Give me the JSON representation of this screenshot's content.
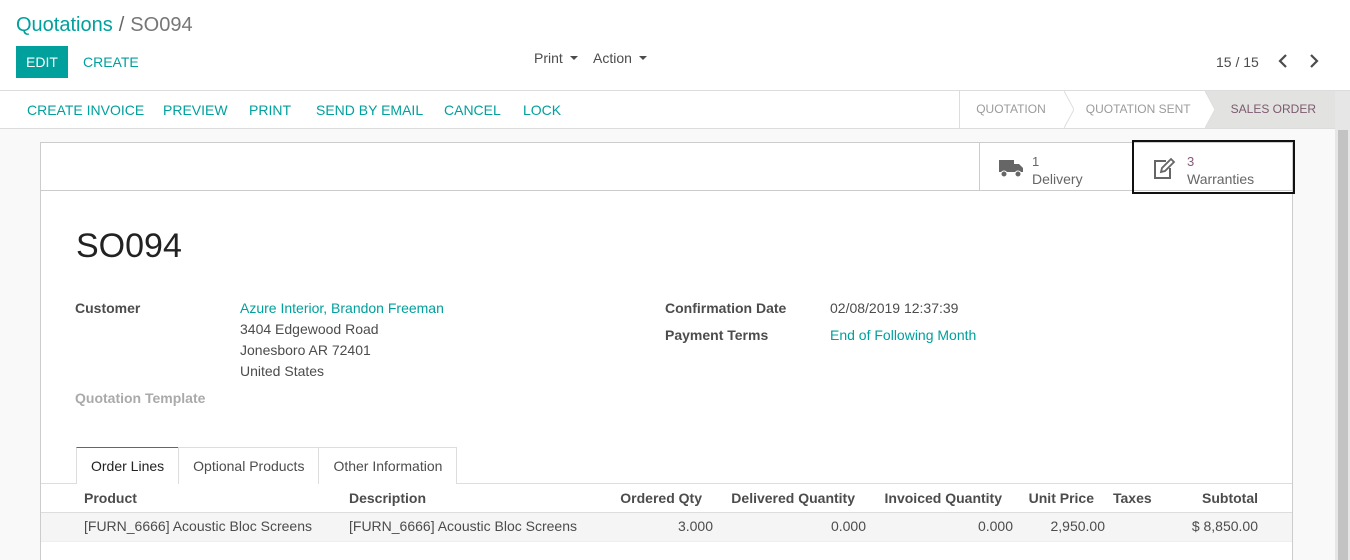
{
  "breadcrumb": {
    "parent": "Quotations",
    "separator": "/",
    "current": "SO094"
  },
  "toolbar": {
    "edit_label": "EDIT",
    "create_label": "CREATE",
    "print_label": "Print",
    "action_label": "Action"
  },
  "pager": {
    "value": "15 / 15"
  },
  "statusbar": {
    "buttons": [
      "CREATE INVOICE",
      "PREVIEW",
      "PRINT",
      "SEND BY EMAIL",
      "CANCEL",
      "LOCK"
    ],
    "stages": [
      {
        "label": "QUOTATION",
        "active": false
      },
      {
        "label": "QUOTATION SENT",
        "active": false
      },
      {
        "label": "SALES ORDER",
        "active": true
      }
    ]
  },
  "smart_buttons": [
    {
      "value": "1",
      "label": "Delivery",
      "icon": "truck-icon"
    },
    {
      "value": "3",
      "label": "Warranties",
      "icon": "edit-icon"
    }
  ],
  "record": {
    "name": "SO094",
    "customer_label": "Customer",
    "customer_name": "Azure Interior, Brandon Freeman",
    "address_line1": "3404 Edgewood Road",
    "address_line2": "Jonesboro AR 72401",
    "address_line3": "United States",
    "quotation_template_label": "Quotation Template",
    "confirmation_date_label": "Confirmation Date",
    "confirmation_date": "02/08/2019 12:37:39",
    "payment_terms_label": "Payment Terms",
    "payment_terms": "End of Following Month"
  },
  "tabs": [
    "Order Lines",
    "Optional Products",
    "Other Information"
  ],
  "order_lines": {
    "columns": [
      "Product",
      "Description",
      "Ordered Qty",
      "Delivered Quantity",
      "Invoiced Quantity",
      "Unit Price",
      "Taxes",
      "Subtotal"
    ],
    "rows": [
      [
        "[FURN_6666] Acoustic Bloc Screens",
        "[FURN_6666] Acoustic Bloc Screens",
        "3.000",
        "0.000",
        "0.000",
        "2,950.00",
        "",
        "$ 8,850.00"
      ]
    ]
  },
  "colors": {
    "accent": "#00a09d",
    "brand": "#875a7b"
  }
}
